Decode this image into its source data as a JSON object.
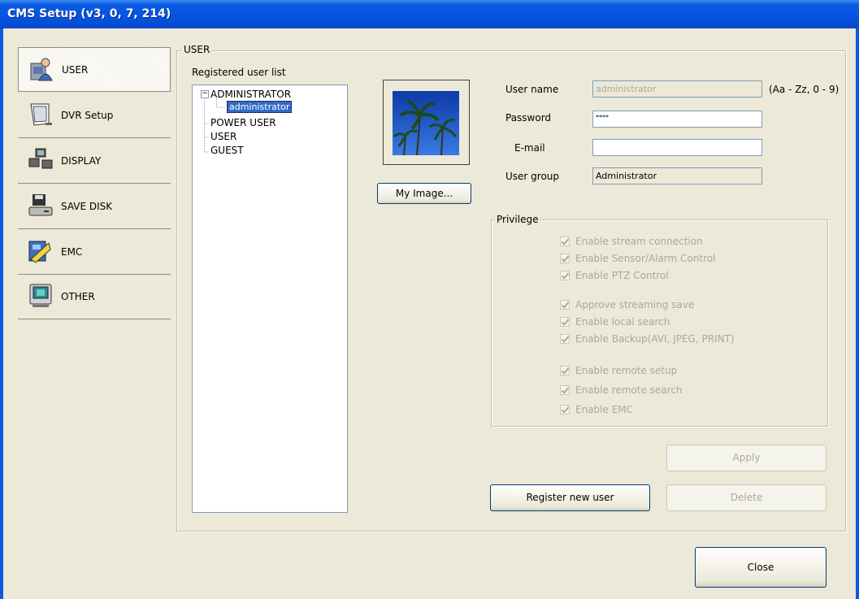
{
  "window": {
    "title": "CMS Setup (v3, 0, 7, 214)"
  },
  "nav": {
    "items": [
      {
        "label": "USER",
        "icon": "user-settings-icon",
        "active": true
      },
      {
        "label": "DVR Setup",
        "icon": "dvr-setup-icon",
        "active": false
      },
      {
        "label": "DISPLAY",
        "icon": "display-icon",
        "active": false
      },
      {
        "label": "SAVE DISK",
        "icon": "save-disk-icon",
        "active": false
      },
      {
        "label": "EMC",
        "icon": "emc-icon",
        "active": false
      },
      {
        "label": "OTHER",
        "icon": "other-icon",
        "active": false
      }
    ]
  },
  "user_panel": {
    "group_title": "USER",
    "list_label": "Registered user list",
    "tree": {
      "groups": [
        "ADMINISTRATOR",
        "POWER USER",
        "USER",
        "GUEST"
      ],
      "admin_children": [
        "administrator"
      ],
      "selected": "administrator"
    },
    "my_image_button": "My Image...",
    "fields": {
      "user_name_label": "User name",
      "user_name_value": "administrator",
      "user_name_hint": "(Aa - Zz, 0 - 9)",
      "password_label": "Password",
      "password_value": "****",
      "email_label": "E-mail",
      "email_value": "",
      "user_group_label": "User group",
      "user_group_value": "Administrator"
    },
    "privilege": {
      "title": "Privilege",
      "items": [
        {
          "label": "Enable stream connection",
          "checked": true,
          "enabled": false
        },
        {
          "label": "Enable Sensor/Alarm Control",
          "checked": true,
          "enabled": false
        },
        {
          "label": "Enable PTZ Control",
          "checked": true,
          "enabled": false
        },
        {
          "label": "Approve streaming save",
          "checked": true,
          "enabled": false
        },
        {
          "label": "Enable local search",
          "checked": true,
          "enabled": false
        },
        {
          "label": "Enable Backup(AVI, JPEG, PRINT)",
          "checked": true,
          "enabled": false
        },
        {
          "label": "Enable remote setup",
          "checked": true,
          "enabled": false
        },
        {
          "label": "Enable remote search",
          "checked": true,
          "enabled": false
        },
        {
          "label": "Enable EMC",
          "checked": true,
          "enabled": false
        }
      ]
    },
    "buttons": {
      "apply": "Apply",
      "register": "Register new user",
      "delete": "Delete"
    }
  },
  "footer": {
    "close": "Close"
  },
  "colors": {
    "titlebar": "#0554e3",
    "face": "#ece9d8",
    "selection": "#316ac5",
    "disabled_text": "#aca899"
  }
}
